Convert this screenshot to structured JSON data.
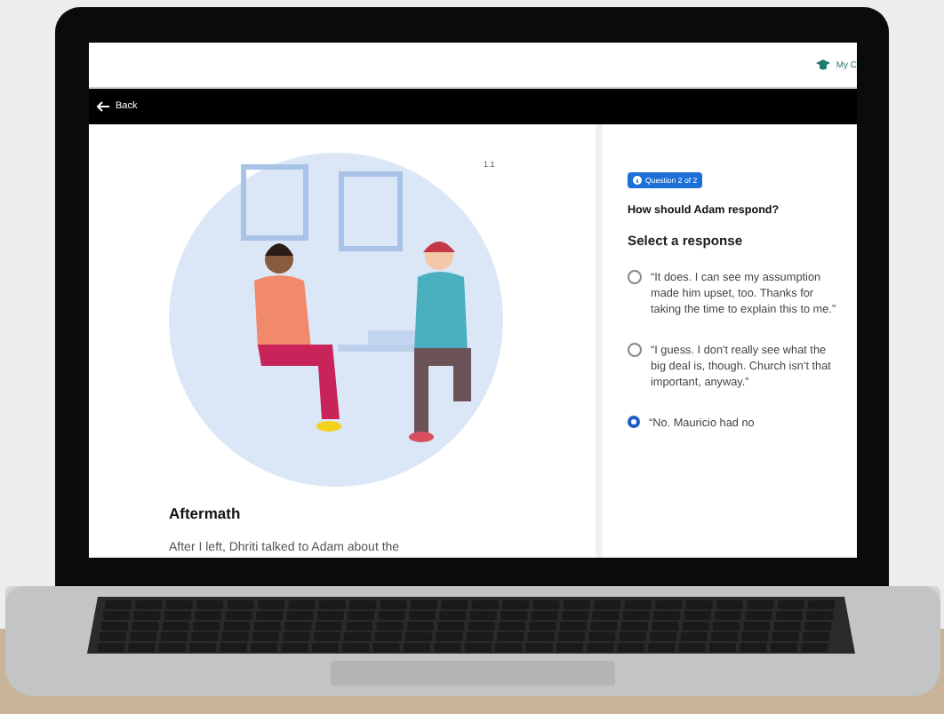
{
  "header": {
    "user_menu": "My C"
  },
  "nav": {
    "back": "Back"
  },
  "story": {
    "step": "1.1",
    "title": "Aftermath",
    "text": "After I left, Dhriti talked to Adam about the"
  },
  "question": {
    "badge": "Question 2 of 2",
    "prompt": "How should Adam respond?",
    "instruction": "Select a response",
    "options": [
      {
        "text": "“It does. I can see my assumption made him upset, too. Thanks for taking the time to explain this to me.”",
        "selected": false
      },
      {
        "text": "“I guess. I don't really see what the big deal is, though. Church isn't that important, anyway.”",
        "selected": false
      },
      {
        "text": "“No. Mauricio had no",
        "selected": true
      }
    ]
  }
}
